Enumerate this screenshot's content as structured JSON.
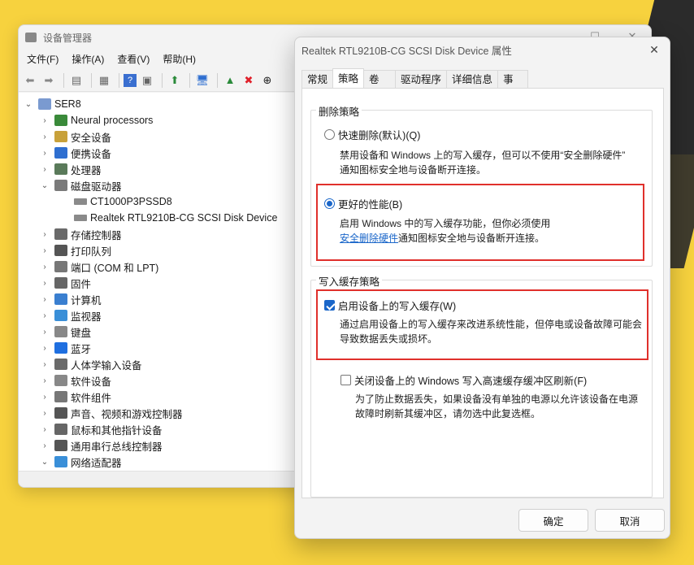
{
  "device_manager": {
    "title": "设备管理器",
    "menu": [
      "文件(F)",
      "操作(A)",
      "查看(V)",
      "帮助(H)"
    ],
    "root": "SER8",
    "tree": [
      {
        "label": "Neural processors",
        "expanded": false,
        "icon_color": "#3a8a3a"
      },
      {
        "label": "安全设备",
        "expanded": false,
        "icon_color": "#c8a13a"
      },
      {
        "label": "便携设备",
        "expanded": false,
        "icon_color": "#2f6fd0"
      },
      {
        "label": "处理器",
        "expanded": false,
        "icon_color": "#5a7a5a"
      },
      {
        "label": "磁盘驱动器",
        "expanded": true,
        "icon_color": "#7a7a7a"
      },
      {
        "label": "CT1000P3PSSD8",
        "child": true
      },
      {
        "label": "Realtek RTL9210B-CG SCSI Disk Device",
        "child": true
      },
      {
        "label": "存储控制器",
        "expanded": false,
        "icon_color": "#6a6a6a"
      },
      {
        "label": "打印队列",
        "expanded": false,
        "icon_color": "#555555"
      },
      {
        "label": "端口 (COM 和 LPT)",
        "expanded": false,
        "icon_color": "#777777"
      },
      {
        "label": "固件",
        "expanded": false,
        "icon_color": "#666666"
      },
      {
        "label": "计算机",
        "expanded": false,
        "icon_color": "#3a7fd0"
      },
      {
        "label": "监视器",
        "expanded": false,
        "icon_color": "#3a8fd8"
      },
      {
        "label": "键盘",
        "expanded": false,
        "icon_color": "#888888"
      },
      {
        "label": "蓝牙",
        "expanded": false,
        "icon_color": "#1f6fe0"
      },
      {
        "label": "人体学输入设备",
        "expanded": false,
        "icon_color": "#6a6a6a"
      },
      {
        "label": "软件设备",
        "expanded": false,
        "icon_color": "#888888"
      },
      {
        "label": "软件组件",
        "expanded": false,
        "icon_color": "#777777"
      },
      {
        "label": "声音、视频和游戏控制器",
        "expanded": false,
        "icon_color": "#555555"
      },
      {
        "label": "鼠标和其他指针设备",
        "expanded": false,
        "icon_color": "#666666"
      },
      {
        "label": "通用串行总线控制器",
        "expanded": false,
        "icon_color": "#555555"
      },
      {
        "label": "网络适配器",
        "expanded": true,
        "icon_color": "#3a8fd8"
      }
    ]
  },
  "dialog": {
    "title": "Realtek RTL9210B-CG SCSI Disk Device 属性",
    "tabs": [
      "常规",
      "策略",
      "卷",
      "驱动程序",
      "详细信息",
      "事件"
    ],
    "active_tab": "策略",
    "removal_group": {
      "label": "删除策略",
      "quick": {
        "label": "快速删除(默认)(Q)",
        "selected": false,
        "desc_line1": "禁用设备和 Windows 上的写入缓存，但可以不使用“安全删除硬件”",
        "desc_line2": "通知图标安全地与设备断开连接。"
      },
      "better": {
        "label": "更好的性能(B)",
        "selected": true,
        "desc_line1": "启用 Windows 中的写入缓存功能，但你必须使用",
        "desc_link": "安全删除硬件",
        "desc_line2_rest": "通知图标安全地与设备断开连接。"
      }
    },
    "write_cache_group": {
      "label": "写入缓存策略",
      "enable": {
        "label": "启用设备上的写入缓存(W)",
        "checked": true,
        "desc_line1": "通过启用设备上的写入缓存来改进系统性能，但停电或设备故障可能会",
        "desc_line2": "导致数据丢失或损坏。"
      },
      "flush": {
        "label": "关闭设备上的 Windows 写入高速缓存缓冲区刷新(F)",
        "checked": false,
        "desc_line1": "为了防止数据丢失，如果设备没有单独的电源以允许该设备在电源",
        "desc_line2": "故障时刷新其缓冲区，请勿选中此复选框。"
      }
    },
    "ok_label": "确定",
    "cancel_label": "取消"
  }
}
